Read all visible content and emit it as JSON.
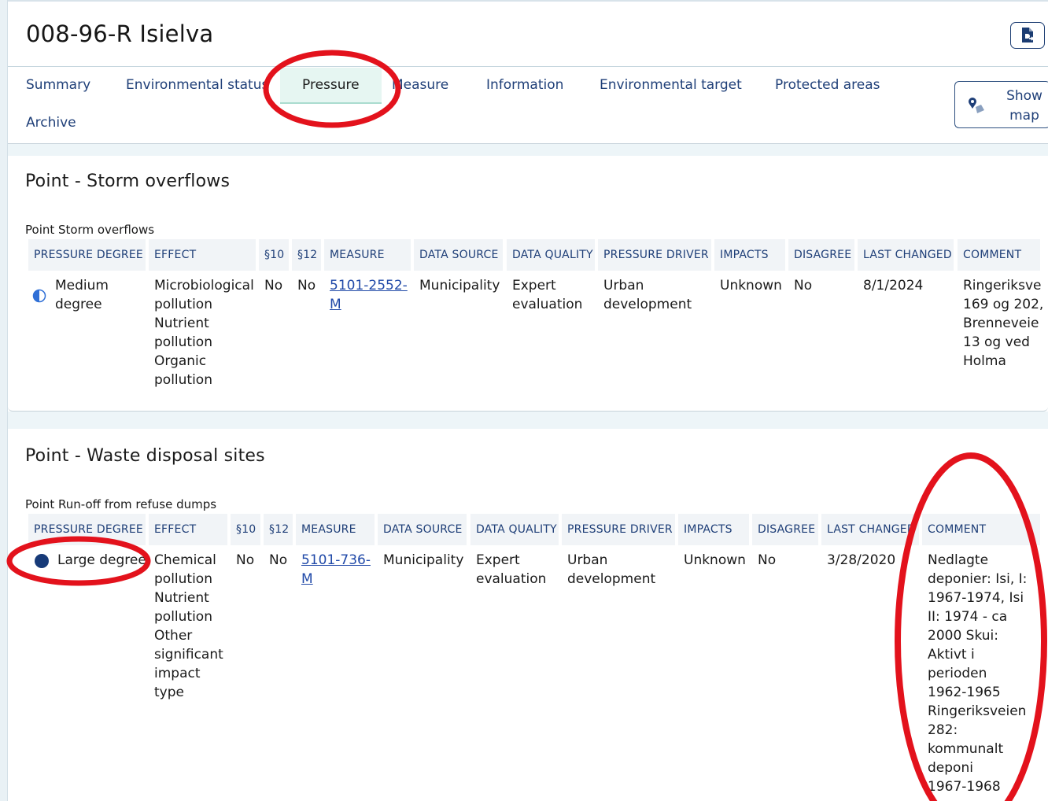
{
  "header": {
    "title": "008-96-R Isielva",
    "export_icon": "document-export-icon"
  },
  "tabs": [
    "Summary",
    "Environmental status",
    "Pressure",
    "Measure",
    "Information",
    "Environmental target",
    "Protected areas",
    "Archive"
  ],
  "active_tab": "Pressure",
  "show_map": {
    "label_line1": "Show",
    "label_line2": "map",
    "icon": "map-marker-icon"
  },
  "columns1": [
    "PRESSURE DEGREE",
    "EFFECT",
    "§10",
    "§12",
    "MEASURE",
    "DATA SOURCE",
    "DATA QUALITY",
    "PRESSURE DRIVER",
    "IMPACTS",
    "DISAGREE",
    "LAST CHANGED",
    "COMMENT"
  ],
  "columns2": [
    "PRESSURE DEGREE",
    "EFFECT",
    "§10",
    "§12",
    "MEASURE",
    "DATA SOURCE",
    "DATA QUALITY",
    "PRESSURE DRIVER",
    "IMPACTS",
    "DISAGREE",
    "LAST CHANGED",
    "COMMENT"
  ],
  "sections": [
    {
      "title": "Point - Storm overflows",
      "subtitle": "Point Storm overflows",
      "row": {
        "degree": "Medium\ndegree",
        "degree_level": 0.5,
        "effect": "Microbiological\npollution\nNutrient\npollution\nOrganic\npollution",
        "p10": "No",
        "p12": "No",
        "measure": "5101-2552-\nM",
        "source": "Municipality",
        "quality": "Expert\nevaluation",
        "driver": "Urban\ndevelopment",
        "impacts": "Unknown",
        "disagree": "No",
        "changed": "8/1/2024",
        "comment": "Ringeriksve\n169 og 202,\nBrenneveie\n13 og ved\nHolma"
      }
    },
    {
      "title": "Point - Waste disposal sites",
      "subtitle": "Point Run-off from refuse dumps",
      "row": {
        "degree": "Large degree",
        "degree_level": 1.0,
        "effect": "Chemical\npollution\nNutrient\npollution\nOther\nsignificant\nimpact\ntype",
        "p10": "No",
        "p12": "No",
        "measure": "5101-736-\nM",
        "source": "Municipality",
        "quality": "Expert\nevaluation",
        "driver": "Urban\ndevelopment",
        "impacts": "Unknown",
        "disagree": "No",
        "changed": "3/28/2020",
        "comment": "Nedlagte\ndeponier: Isi, I:\n1967-1974, Isi\nII: 1974 - ca\n2000 Skui:\nAktivt i\nperioden\n1962-1965\nRingeriksveien\n282:\nkommunalt\ndeponi\n1967-1968"
      }
    }
  ],
  "colors": {
    "link": "#1f3f78",
    "header_bg": "#f1f4f7",
    "annotation": "#e3121c",
    "dot": "#173a78"
  }
}
